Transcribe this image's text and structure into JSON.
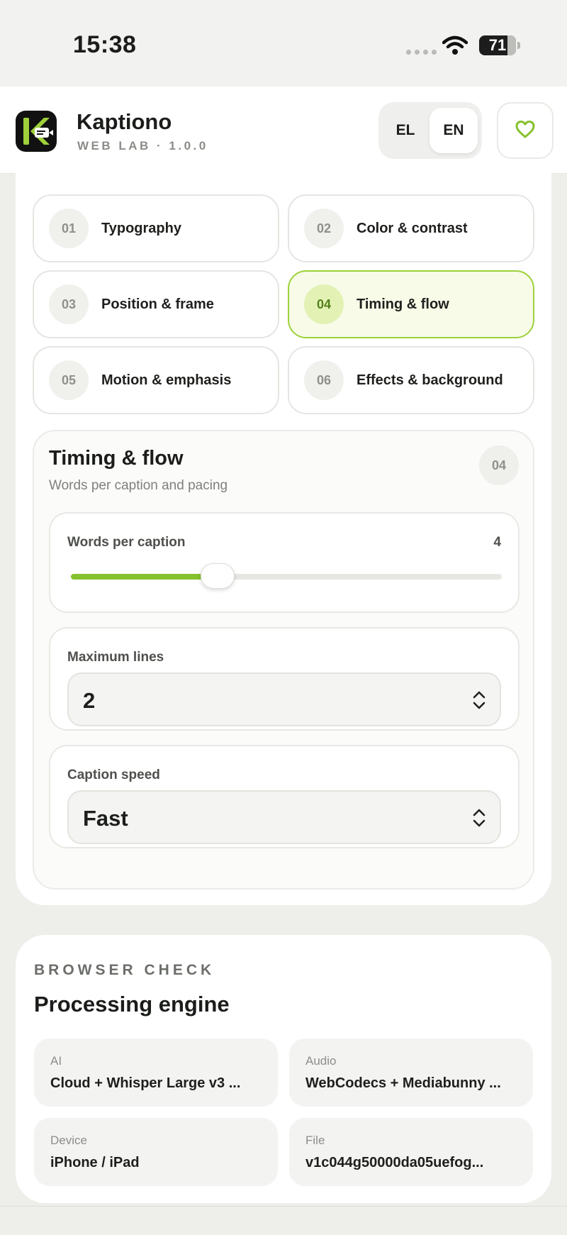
{
  "status_bar": {
    "time": "15:38",
    "battery": "71"
  },
  "header": {
    "app_name": "Kaptiono",
    "app_subtitle": "WEB LAB · 1.0.0",
    "languages": [
      "EL",
      "EN"
    ],
    "active_language": "EN"
  },
  "tabs": [
    {
      "num": "01",
      "label": "Typography",
      "active": false
    },
    {
      "num": "02",
      "label": "Color & contrast",
      "active": false
    },
    {
      "num": "03",
      "label": "Position & frame",
      "active": false
    },
    {
      "num": "04",
      "label": "Timing & flow",
      "active": true
    },
    {
      "num": "05",
      "label": "Motion & emphasis",
      "active": false
    },
    {
      "num": "06",
      "label": "Effects & background",
      "active": false
    }
  ],
  "section": {
    "title": "Timing & flow",
    "subtitle": "Words per caption and pacing",
    "num": "04",
    "words_per_caption": {
      "label": "Words per caption",
      "value": "4",
      "level_fraction": 0.34
    },
    "max_lines": {
      "label": "Maximum lines",
      "value": "2"
    },
    "caption_speed": {
      "label": "Caption speed",
      "value": "Fast"
    }
  },
  "processing": {
    "overline": "BROWSER CHECK",
    "title": "Processing engine",
    "items": [
      {
        "key": "AI",
        "value": "Cloud + Whisper Large v3 ..."
      },
      {
        "key": "Audio",
        "value": "WebCodecs + Mediabunny ..."
      },
      {
        "key": "Device",
        "value": "iPhone / iPad"
      },
      {
        "key": "File",
        "value": "v1c044g50000da05uefog..."
      }
    ]
  },
  "colors": {
    "accent": "#86c12e",
    "active_tab_bg": "#f7fbe8",
    "active_tab_border": "#9ed13a"
  }
}
